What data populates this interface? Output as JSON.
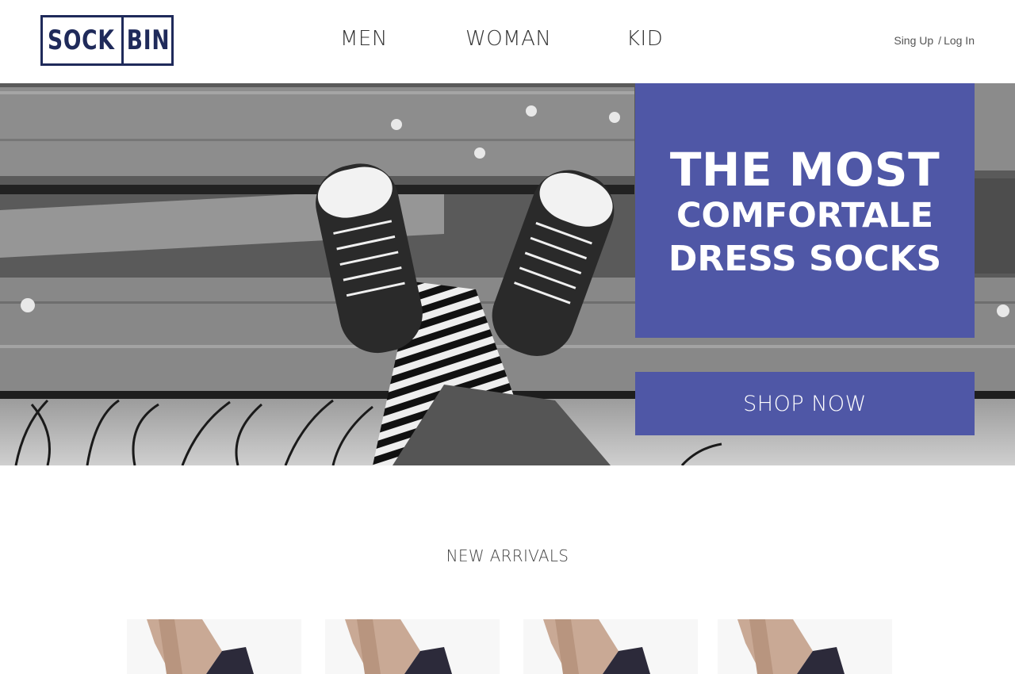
{
  "brand": {
    "logo_left": "SOCK",
    "logo_right": "BIN"
  },
  "nav": {
    "items": [
      "MEN",
      "WOMAN",
      "KID"
    ]
  },
  "auth": {
    "signup": "Sing Up",
    "separator": "/",
    "login": "Log In"
  },
  "hero": {
    "headline_line1": "THE MOST",
    "headline_line2": "COMFORTALE",
    "headline_line3": "DRESS SOCKS",
    "cta": "SHOP NOW",
    "accent_color": "#4f57a6"
  },
  "new_arrivals": {
    "title": "NEW ARRIVALS",
    "products": [
      {
        "icon": "sock-product-image"
      },
      {
        "icon": "sock-product-image"
      },
      {
        "icon": "sock-product-image"
      },
      {
        "icon": "sock-product-image"
      }
    ]
  },
  "colors": {
    "brand_navy": "#1f2a5a",
    "accent": "#4f57a6"
  }
}
